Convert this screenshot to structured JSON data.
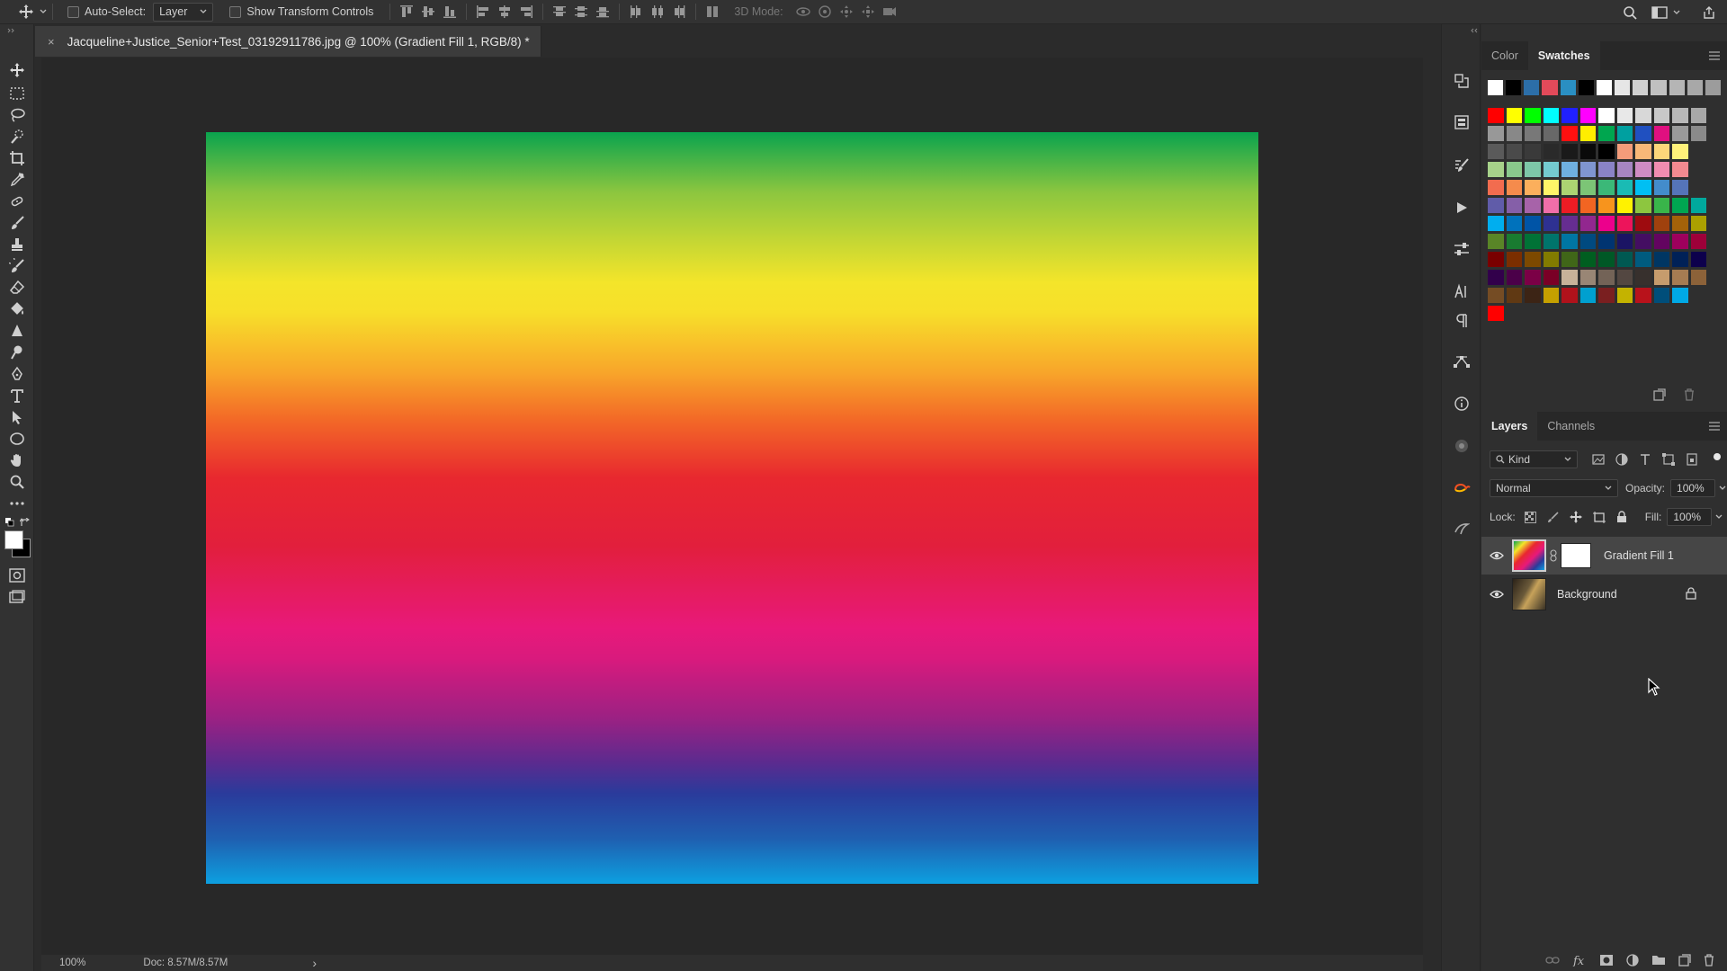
{
  "options_bar": {
    "auto_select_label": "Auto-Select:",
    "auto_select_target": "Layer",
    "show_transform_label": "Show Transform Controls",
    "mode_3d_label": "3D Mode:"
  },
  "document": {
    "tab_title": "Jacqueline+Justice_Senior+Test_03192911786.jpg @ 100% (Gradient Fill 1, RGB/8) *",
    "close_glyph": "×"
  },
  "status_bar": {
    "zoom": "100%",
    "doc_size": "Doc: 8.57M/8.57M",
    "arrow": "›"
  },
  "color_panel": {
    "tabs": [
      "Color",
      "Swatches"
    ],
    "active_tab": "Swatches"
  },
  "swatch_rows": [
    [
      "#ffffff",
      "#000000",
      "#2c6ea8",
      "#e24a5a",
      "#2a8fc2",
      "#000000",
      "#ffffff",
      "#e6e6e6",
      "#d0d0d0",
      "#c0c0c0",
      "#b5b5b5",
      "#a8a8a8",
      "#9c9c9c"
    ],
    [
      "#ff0000",
      "#ffff00",
      "#00ff00",
      "#00ffff",
      "#2020ff",
      "#ff00ff",
      "#ffffff",
      "#e8e8e8",
      "#d8d8d8",
      "#c8c8c8",
      "#b8b8b8",
      "#a8a8a8"
    ],
    [
      "#989898",
      "#888888",
      "#787878",
      "#686868",
      "#ff1010",
      "#ffee00",
      "#00a64f",
      "#00a0a0",
      "#2050c0",
      "#e01080",
      "#9a9a9a",
      "#8a8a8a"
    ],
    [
      "#5a5a5a",
      "#4a4a4a",
      "#3a3a3a",
      "#2a2a2a",
      "#1a1a1a",
      "#0a0a0a",
      "#000000",
      "#f49c7a",
      "#f8b878",
      "#fcd67a",
      "#fff17a"
    ],
    [
      "#a7d28a",
      "#8ac98c",
      "#7dc7a8",
      "#74cbd0",
      "#6fb0e0",
      "#7f95d0",
      "#8a83c6",
      "#a786c2",
      "#cf8cc4",
      "#f08cb0",
      "#f28a90"
    ],
    [
      "#f26c4f",
      "#f58b4c",
      "#fbaf5c",
      "#fff568",
      "#acd372",
      "#7cc576",
      "#3bb878",
      "#1abbb4",
      "#00bff3",
      "#438ccb",
      "#5574b9"
    ],
    [
      "#605ca9",
      "#855fa8",
      "#a763a9",
      "#f06ea9",
      "#ed1c24",
      "#f26522",
      "#f7941d",
      "#fff200",
      "#8dc63f",
      "#39b54a",
      "#00a651",
      "#00a99d"
    ],
    [
      "#00aeef",
      "#0072bc",
      "#0054a6",
      "#2e3192",
      "#662d91",
      "#92278f",
      "#ec008c",
      "#ed145b",
      "#9e0b0f",
      "#a0410d",
      "#a36209",
      "#aba000"
    ],
    [
      "#598527",
      "#197b30",
      "#007236",
      "#00746b",
      "#0076a3",
      "#004a80",
      "#003471",
      "#1b1464",
      "#440e62",
      "#630460",
      "#9e005d",
      "#9e0039"
    ],
    [
      "#790000",
      "#7b2e00",
      "#7d4900",
      "#827b00",
      "#406618",
      "#005e20",
      "#005826",
      "#005952",
      "#005b7f",
      "#003663",
      "#002157",
      "#0d004c"
    ],
    [
      "#32004b",
      "#4b0049",
      "#7b0046",
      "#7a0026",
      "#c7b299",
      "#998675",
      "#736357",
      "#534741",
      "#37302d",
      "#c69c6d",
      "#a67c52",
      "#8c6239"
    ],
    [
      "#754c24",
      "#603913",
      "#3c2415",
      "#c5a000",
      "#b0121b",
      "#00a0d0",
      "#7a1f20",
      "#c4b300",
      "#b8121b",
      "#004e7a",
      "#00a9e5"
    ],
    [
      "#ff0000"
    ]
  ],
  "layers_panel": {
    "tabs": [
      "Layers",
      "Channels"
    ],
    "active_tab": "Layers",
    "filter_kind": "Kind",
    "blend_mode": "Normal",
    "opacity_label": "Opacity:",
    "opacity_value": "100%",
    "lock_label": "Lock:",
    "fill_label": "Fill:",
    "fill_value": "100%",
    "layers": [
      {
        "name": "Gradient Fill 1",
        "visible": true,
        "selected": true,
        "locked": false
      },
      {
        "name": "Background",
        "visible": true,
        "selected": false,
        "locked": true
      }
    ]
  },
  "colors": {
    "foreground": "#ffffff",
    "background": "#000000"
  }
}
